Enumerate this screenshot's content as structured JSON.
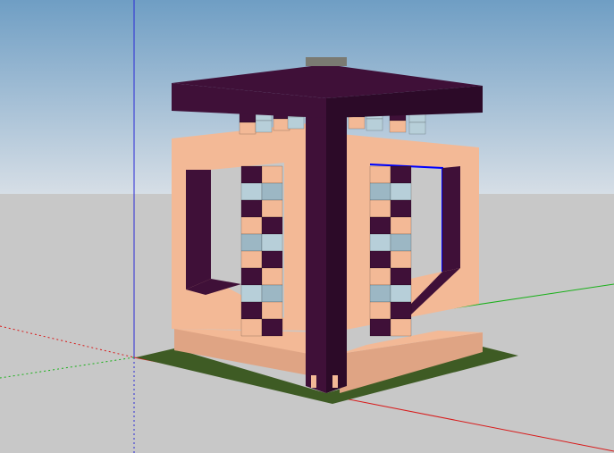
{
  "app": {
    "view": "3d-model-viewport"
  },
  "colors": {
    "sky_top": "#6f9ec4",
    "sky_bottom": "#d6dee6",
    "ground": "#c8c8c8",
    "frame_dark": "#3f1038",
    "frame_dark_side": "#2c0a28",
    "wall_peach": "#f3b996",
    "wall_peach_dark": "#dfa484",
    "glass": "#b7cfd9",
    "glass_dark": "#9cb7c4",
    "plinth_green": "#3e5b24",
    "roof_vent": "#7a7a72",
    "selection_blue": "#0000ff",
    "axis_blue": "#2b2bd6",
    "axis_red": "#d81a1a",
    "axis_green": "#1ab01a"
  }
}
